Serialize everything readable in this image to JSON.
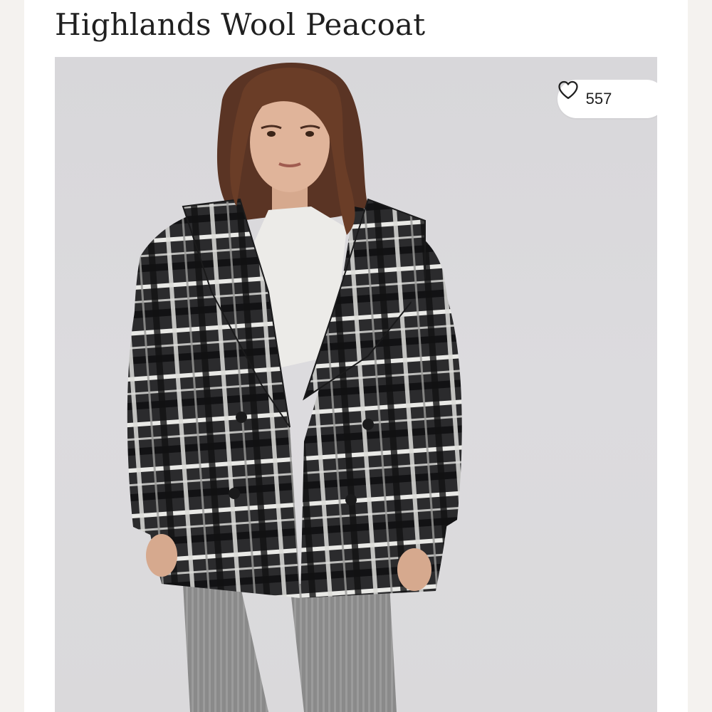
{
  "product": {
    "title": "Highlands Wool Peacoat"
  },
  "likes": {
    "count": "557",
    "icon": "heart-icon"
  },
  "photo": {
    "description_icon": "product-photo"
  }
}
